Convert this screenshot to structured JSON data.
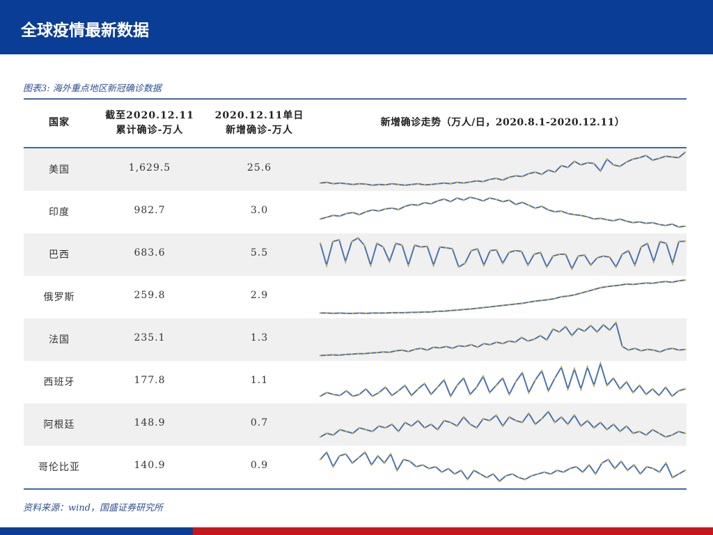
{
  "header": {
    "title": "全球疫情最新数据"
  },
  "caption": "图表3: 海外重点地区新冠确诊数据",
  "source": "资料来源：wind，国盛证券研究所",
  "colors": {
    "line": "#4a72b0",
    "marker": "#e0b020",
    "header_bg": "#0a3d96",
    "accent_red": "#c8161d"
  },
  "chart_data": {
    "type": "table",
    "columns": [
      "国家",
      "截至2020.12.11 累计确诊-万人",
      "2020.12.11单日 新增确诊-万人",
      "新增确诊走势（万人/日，2020.8.1-2020.12.11）"
    ],
    "col_lines": {
      "c1a": "截至2020.12.11",
      "c1b": "累计确诊-万人",
      "c2a": "2020.12.11单日",
      "c2b": "新增确诊-万人"
    },
    "rows": [
      {
        "country": "美国",
        "cumulative": "1,629.5",
        "daily": "25.6",
        "trend": [
          0.12,
          0.14,
          0.1,
          0.12,
          0.1,
          0.08,
          0.1,
          0.09,
          0.06,
          0.08,
          0.07,
          0.1,
          0.08,
          0.06,
          0.08,
          0.1,
          0.07,
          0.08,
          0.1,
          0.12,
          0.1,
          0.14,
          0.12,
          0.15,
          0.18,
          0.16,
          0.22,
          0.25,
          0.2,
          0.28,
          0.32,
          0.3,
          0.38,
          0.42,
          0.36,
          0.48,
          0.42,
          0.6,
          0.55,
          0.72,
          0.62,
          0.68,
          0.66,
          0.45,
          0.78,
          0.62,
          0.58,
          0.7,
          0.78,
          0.82,
          0.88,
          0.75,
          0.8,
          0.86,
          0.84,
          0.82,
          0.97
        ]
      },
      {
        "country": "印度",
        "cumulative": "982.7",
        "daily": "3.0",
        "trend": [
          0.3,
          0.35,
          0.4,
          0.38,
          0.45,
          0.48,
          0.42,
          0.5,
          0.55,
          0.52,
          0.58,
          0.6,
          0.56,
          0.65,
          0.7,
          0.68,
          0.75,
          0.72,
          0.8,
          0.85,
          0.78,
          0.88,
          0.82,
          0.9,
          0.86,
          0.8,
          0.88,
          0.84,
          0.78,
          0.82,
          0.7,
          0.76,
          0.68,
          0.6,
          0.65,
          0.55,
          0.5,
          0.52,
          0.45,
          0.42,
          0.4,
          0.36,
          0.3,
          0.32,
          0.28,
          0.25,
          0.3,
          0.24,
          0.2,
          0.22,
          0.18,
          0.2,
          0.15,
          0.12,
          0.16,
          0.08,
          0.1
        ]
      },
      {
        "country": "巴西",
        "cumulative": "683.6",
        "daily": "5.5",
        "trend": [
          0.8,
          0.2,
          0.85,
          0.9,
          0.3,
          0.85,
          0.95,
          0.75,
          0.2,
          0.8,
          0.7,
          0.3,
          0.8,
          0.75,
          0.2,
          0.75,
          0.7,
          0.72,
          0.2,
          0.7,
          0.68,
          0.65,
          0.15,
          0.25,
          0.6,
          0.65,
          0.2,
          0.6,
          0.62,
          0.25,
          0.55,
          0.6,
          0.58,
          0.2,
          0.5,
          0.55,
          0.15,
          0.45,
          0.5,
          0.5,
          0.1,
          0.45,
          0.48,
          0.2,
          0.4,
          0.45,
          0.42,
          0.15,
          0.5,
          0.6,
          0.2,
          0.7,
          0.8,
          0.3,
          0.85,
          0.8,
          0.25,
          0.85,
          0.86
        ]
      },
      {
        "country": "俄罗斯",
        "cumulative": "259.8",
        "daily": "2.9",
        "trend": [
          0.05,
          0.05,
          0.04,
          0.05,
          0.04,
          0.04,
          0.05,
          0.04,
          0.05,
          0.05,
          0.05,
          0.06,
          0.06,
          0.06,
          0.07,
          0.07,
          0.08,
          0.08,
          0.1,
          0.1,
          0.12,
          0.13,
          0.15,
          0.16,
          0.18,
          0.2,
          0.22,
          0.24,
          0.26,
          0.28,
          0.3,
          0.32,
          0.35,
          0.38,
          0.4,
          0.42,
          0.45,
          0.5,
          0.52,
          0.55,
          0.6,
          0.65,
          0.7,
          0.75,
          0.78,
          0.8,
          0.82,
          0.85,
          0.84,
          0.86,
          0.88,
          0.87,
          0.9,
          0.92,
          0.9,
          0.94,
          0.96
        ]
      },
      {
        "country": "法国",
        "cumulative": "235.1",
        "daily": "1.3",
        "trend": [
          0.05,
          0.06,
          0.07,
          0.06,
          0.08,
          0.09,
          0.1,
          0.1,
          0.12,
          0.13,
          0.15,
          0.14,
          0.18,
          0.2,
          0.16,
          0.22,
          0.25,
          0.2,
          0.28,
          0.26,
          0.3,
          0.25,
          0.32,
          0.3,
          0.35,
          0.28,
          0.38,
          0.35,
          0.42,
          0.38,
          0.45,
          0.42,
          0.55,
          0.45,
          0.5,
          0.6,
          0.48,
          0.78,
          0.7,
          0.85,
          0.6,
          0.8,
          0.72,
          0.88,
          0.7,
          0.9,
          0.75,
          0.96,
          0.3,
          0.2,
          0.25,
          0.18,
          0.22,
          0.2,
          0.15,
          0.22,
          0.25,
          0.2,
          0.22
        ]
      },
      {
        "country": "西班牙",
        "cumulative": "177.8",
        "daily": "1.1",
        "trend": [
          0.1,
          0.2,
          0.15,
          0.12,
          0.25,
          0.1,
          0.15,
          0.3,
          0.1,
          0.2,
          0.35,
          0.12,
          0.25,
          0.4,
          0.12,
          0.3,
          0.45,
          0.15,
          0.35,
          0.55,
          0.1,
          0.4,
          0.6,
          0.15,
          0.35,
          0.65,
          0.2,
          0.4,
          0.6,
          0.15,
          0.5,
          0.75,
          0.2,
          0.55,
          0.8,
          0.25,
          0.6,
          0.9,
          0.3,
          0.85,
          0.3,
          0.9,
          0.4,
          1.0,
          0.4,
          0.6,
          0.3,
          0.5,
          0.2,
          0.4,
          0.15,
          0.3,
          0.12,
          0.35,
          0.1,
          0.25,
          0.3
        ]
      },
      {
        "country": "阿根廷",
        "cumulative": "148.9",
        "daily": "0.7",
        "trend": [
          0.15,
          0.25,
          0.2,
          0.35,
          0.3,
          0.25,
          0.4,
          0.35,
          0.3,
          0.45,
          0.4,
          0.5,
          0.3,
          0.55,
          0.45,
          0.6,
          0.4,
          0.5,
          0.35,
          0.6,
          0.55,
          0.45,
          0.7,
          0.5,
          0.4,
          0.65,
          0.6,
          0.75,
          0.45,
          0.7,
          0.6,
          0.55,
          0.8,
          0.5,
          0.65,
          0.85,
          0.55,
          0.7,
          0.5,
          0.75,
          0.45,
          0.6,
          0.4,
          0.55,
          0.35,
          0.5,
          0.3,
          0.45,
          0.25,
          0.3,
          0.2,
          0.35,
          0.25,
          0.15,
          0.2,
          0.3,
          0.25
        ]
      },
      {
        "country": "哥伦比亚",
        "cumulative": "140.9",
        "daily": "0.9",
        "trend": [
          0.7,
          0.9,
          0.5,
          0.8,
          0.85,
          0.6,
          0.75,
          0.9,
          0.55,
          0.8,
          0.6,
          0.85,
          0.4,
          0.7,
          0.65,
          0.5,
          0.55,
          0.45,
          0.5,
          0.35,
          0.45,
          0.3,
          0.4,
          0.15,
          0.4,
          0.3,
          0.2,
          0.3,
          0.1,
          0.25,
          0.3,
          0.2,
          0.15,
          0.25,
          0.3,
          0.35,
          0.3,
          0.4,
          0.35,
          0.45,
          0.5,
          0.35,
          0.55,
          0.3,
          0.6,
          0.7,
          0.45,
          0.65,
          0.4,
          0.55,
          0.3,
          0.5,
          0.45,
          0.35,
          0.6,
          0.2,
          0.3,
          0.4
        ]
      }
    ]
  }
}
